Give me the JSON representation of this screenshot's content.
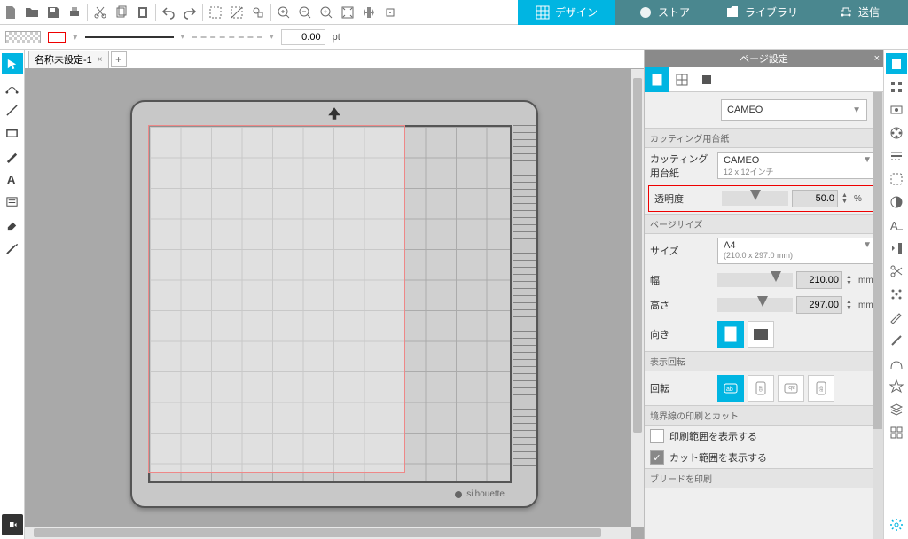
{
  "topnav": {
    "design": "デザイン",
    "store": "ストア",
    "library": "ライブラリ",
    "send": "送信"
  },
  "secondbar": {
    "stroke_value": "0.00",
    "unit": "pt"
  },
  "doc_tab": {
    "name": "名称未設定-1"
  },
  "mat": {
    "brand": "silhouette"
  },
  "panel": {
    "title": "ページ設定",
    "machine_selected": "CAMEO",
    "section_cutmat": "カッティング用台紙",
    "cutmat_label": "カッティング用台紙",
    "cutmat_selected": "CAMEO",
    "cutmat_sub": "12 x 12インチ",
    "opacity_label": "透明度",
    "opacity_value": "50.0",
    "opacity_unit": "%",
    "section_pagesize": "ページサイズ",
    "size_label": "サイズ",
    "size_selected": "A4",
    "size_sub": "(210.0 x 297.0 mm)",
    "width_label": "幅",
    "width_value": "210.00",
    "height_label": "高さ",
    "height_value": "297.00",
    "mm": "mm",
    "orient_label": "向き",
    "section_rotation": "表示回転",
    "rotation_label": "回転",
    "section_bounds": "境界線の印刷とカット",
    "print_area": "印刷範囲を表示する",
    "cut_area": "カット範囲を表示する",
    "section_bleed": "ブリードを印刷"
  }
}
